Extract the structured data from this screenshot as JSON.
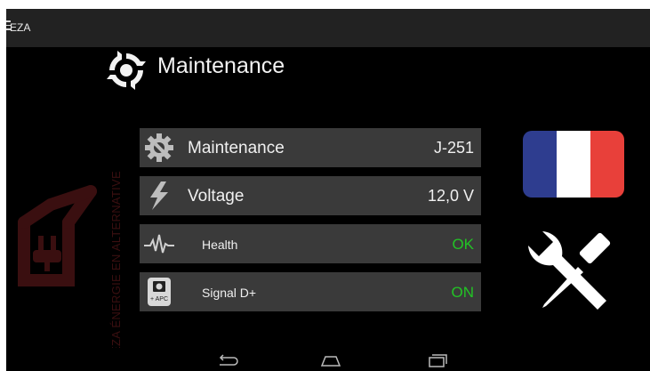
{
  "app": {
    "name": "EZA"
  },
  "page": {
    "title": "Maintenance"
  },
  "watermark": {
    "text": "EZA ÉNERGIE EN ALTERNATIVE"
  },
  "rows": [
    {
      "icon": "gear-wrench-icon",
      "label": "Maintenance",
      "value": "J-251"
    },
    {
      "icon": "lightning-icon",
      "label": "Voltage",
      "value": "12,0 V"
    },
    {
      "icon": "heartbeat-icon",
      "label": "Health",
      "value": "OK",
      "value_color": "#22c325"
    },
    {
      "icon": "apc-socket-icon",
      "label": "Signal D+",
      "value": "ON",
      "value_color": "#22c325",
      "icon_caption": "+ APC"
    }
  ],
  "side": {
    "language_flag": "france-flag-icon",
    "flag_colors": [
      "#2e3d8f",
      "#ffffff",
      "#e8403a"
    ],
    "tools": "tools-icon"
  },
  "navbar": {
    "items": [
      "back-icon",
      "home-icon",
      "recent-apps-icon"
    ]
  },
  "colors": {
    "status_ok": "#22c325",
    "row_bg": "#3a3a3a",
    "topbar_bg": "#222222"
  }
}
